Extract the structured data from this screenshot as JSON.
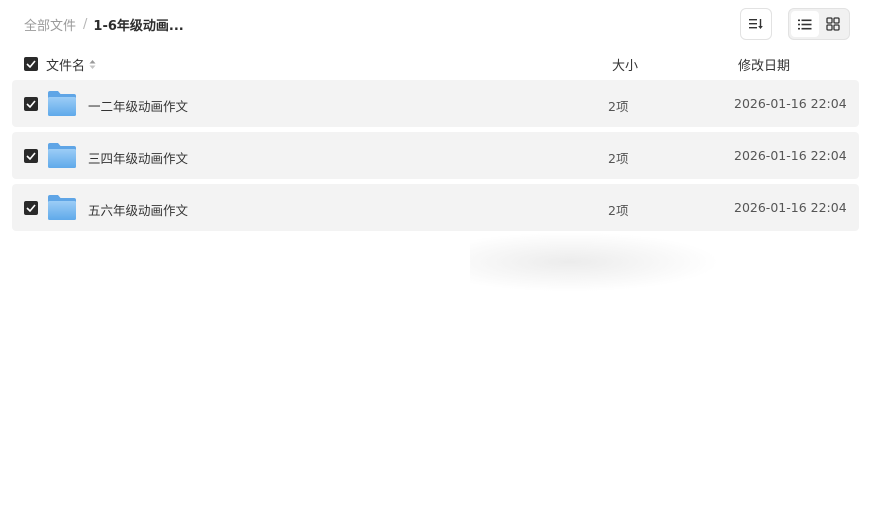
{
  "breadcrumb": {
    "root": "全部文件",
    "separator": "/",
    "current": "1-6年级动画..."
  },
  "toolbar": {
    "sort_icon": "sort-lines-icon",
    "list_view_icon": "list-view-icon",
    "grid_view_icon": "grid-view-icon",
    "active_view": "list"
  },
  "header": {
    "name": "文件名",
    "size": "大小",
    "date": "修改日期"
  },
  "files": [
    {
      "name": "一二年级动画作文",
      "size": "2项",
      "date": "2026-01-16 22:04",
      "checked": true
    },
    {
      "name": "三四年级动画作文",
      "size": "2项",
      "date": "2026-01-16 22:04",
      "checked": true
    },
    {
      "name": "五六年级动画作文",
      "size": "2项",
      "date": "2026-01-16 22:04",
      "checked": true
    }
  ],
  "colors": {
    "row_bg": "#f3f3f3",
    "checkbox": "#2a2a2a",
    "folder": "#6fb3ee"
  }
}
